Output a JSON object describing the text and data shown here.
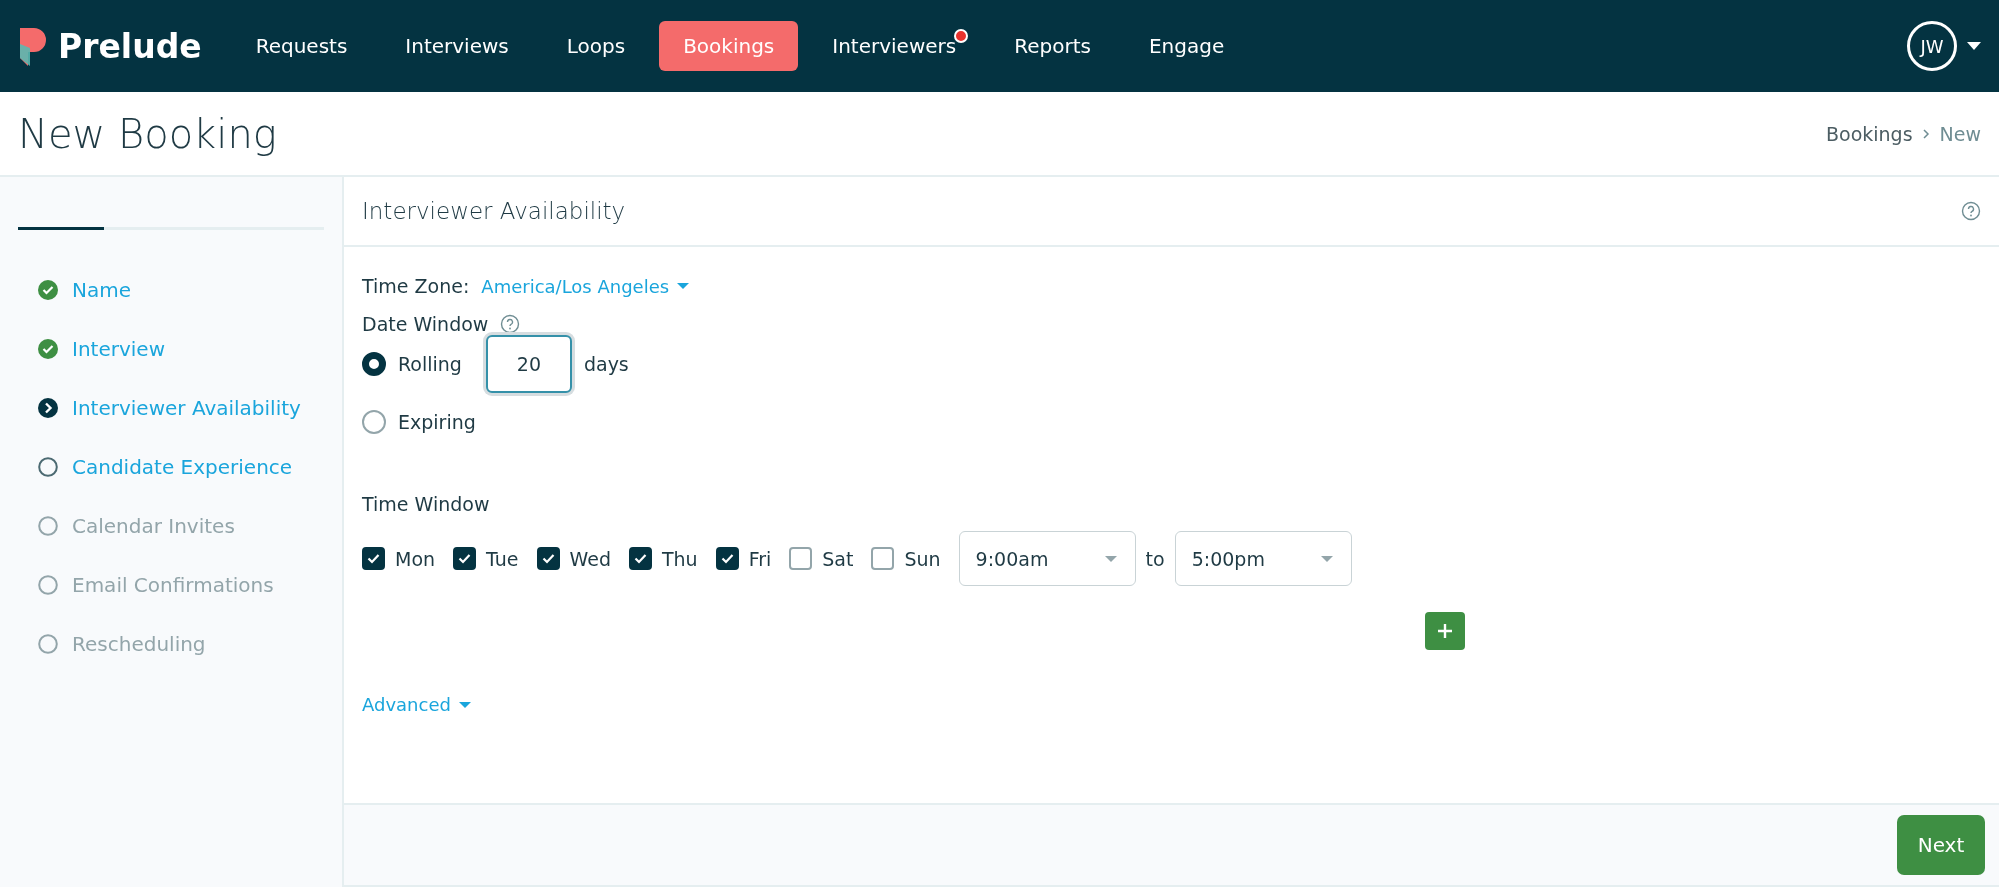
{
  "top_nav": {
    "logo": "Prelude",
    "items": [
      {
        "label": "Requests",
        "selected": false,
        "notification": false
      },
      {
        "label": "Interviews",
        "selected": false,
        "notification": false
      },
      {
        "label": "Loops",
        "selected": false,
        "notification": false
      },
      {
        "label": "Bookings",
        "selected": true,
        "notification": false
      },
      {
        "label": "Interviewers",
        "selected": false,
        "notification": true
      },
      {
        "label": "Reports",
        "selected": false,
        "notification": false
      },
      {
        "label": "Engage",
        "selected": false,
        "notification": false
      }
    ],
    "user": {
      "initials": "JW"
    }
  },
  "page": {
    "title": "New Booking",
    "breadcrumb": [
      "Bookings",
      "New"
    ]
  },
  "sidebar": {
    "progress": {
      "level": 0.28
    },
    "steps": [
      {
        "label": "Name",
        "kind": "complete"
      },
      {
        "label": "Interview",
        "kind": "complete"
      },
      {
        "label": "Interviewer Availability",
        "kind": "current"
      },
      {
        "label": "Candidate Experience",
        "kind": "available"
      },
      {
        "label": "Calendar Invites",
        "kind": "locked"
      },
      {
        "label": "Email Confirmations",
        "kind": "locked"
      },
      {
        "label": "Rescheduling",
        "kind": "locked"
      }
    ]
  },
  "panel": {
    "title": "Interviewer Availability",
    "time_zone": {
      "label": "Time Zone:",
      "value": "America/Los Angeles"
    },
    "date_window": {
      "label": "Date Window",
      "options": [
        {
          "label": "Rolling",
          "selected": true,
          "value": "20",
          "unit": "days"
        },
        {
          "label": "Expiring",
          "selected": false
        }
      ]
    },
    "time_window": {
      "label": "Time Window",
      "days": [
        {
          "label": "Mon",
          "checked": true
        },
        {
          "label": "Tue",
          "checked": true
        },
        {
          "label": "Wed",
          "checked": true
        },
        {
          "label": "Thu",
          "checked": true
        },
        {
          "label": "Fri",
          "checked": true
        },
        {
          "label": "Sat",
          "checked": false
        },
        {
          "label": "Sun",
          "checked": false
        }
      ],
      "start": "9:00am",
      "separator": "to",
      "end": "5:00pm"
    },
    "advanced": "Advanced",
    "next_button": "Next"
  }
}
